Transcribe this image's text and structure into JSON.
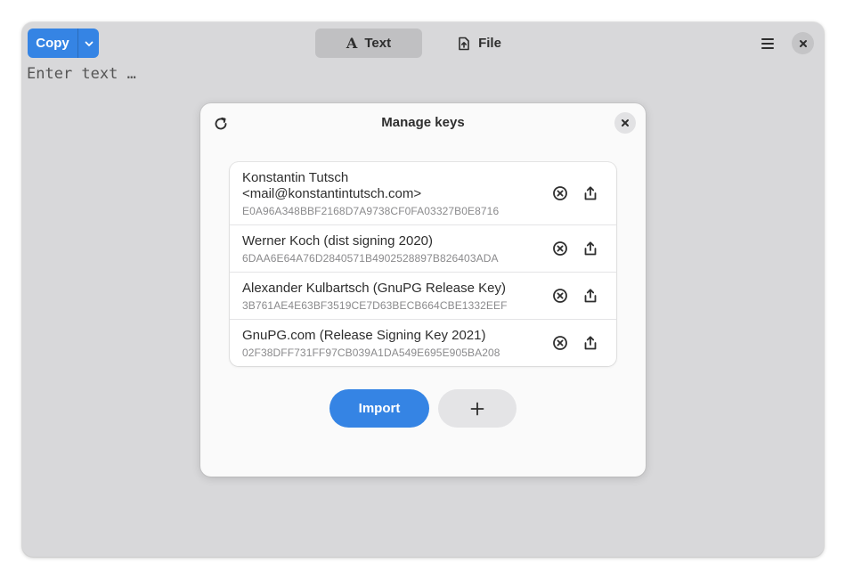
{
  "header": {
    "copy_label": "Copy",
    "modes": [
      {
        "label": "Text",
        "icon": "text-format-icon",
        "active": true
      },
      {
        "label": "File",
        "icon": "file-upload-icon",
        "active": false
      }
    ]
  },
  "editor": {
    "placeholder": "Enter text …"
  },
  "dialog": {
    "title": "Manage keys",
    "keys": [
      {
        "name": "Konstantin Tutsch <mail@konstantintutsch.com>",
        "fingerprint": "E0A96A348BBF2168D7A9738CF0FA03327B0E8716"
      },
      {
        "name": "Werner Koch (dist signing 2020)",
        "fingerprint": "6DAA6E64A76D2840571B4902528897B826403ADA"
      },
      {
        "name": "Alexander Kulbartsch (GnuPG Release Key)",
        "fingerprint": "3B761AE4E63BF3519CE7D63BECB664CBE1332EEF"
      },
      {
        "name": "GnuPG.com (Release Signing Key 2021)",
        "fingerprint": "02F38DFF731FF97CB039A1DA549E695E905BA208"
      }
    ],
    "import_label": "Import",
    "add_symbol": "+"
  },
  "colors": {
    "accent": "#3584e4",
    "window_bg": "#d8d8da",
    "dialog_bg": "#fafafa"
  }
}
